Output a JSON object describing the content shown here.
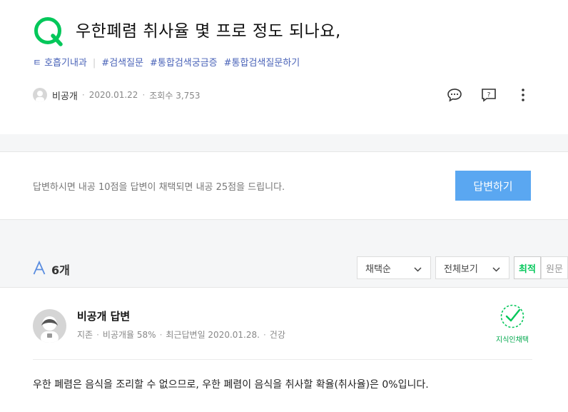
{
  "question": {
    "title": "우한폐렴 취사율 몇 프로 정도 되나요,",
    "tags_prefix": "ㅌ 호흡기내과",
    "tags": [
      "#검색질문",
      "#통합검색궁금증",
      "#통합검색질문하기"
    ],
    "author": "비공개",
    "date": "2020.01.22",
    "views": "조회수 3,753"
  },
  "answer_prompt": {
    "text": "답변하시면 내공 10점을 답변이 채택되면 내공 25점을 드립니다.",
    "button": "답변하기"
  },
  "answers_header": {
    "count": "6개",
    "sort": "채택순",
    "view": "전체보기",
    "tab_latest": "최적",
    "tab_other": "원문"
  },
  "answer": {
    "title": "비공개 답변",
    "grade": "지존",
    "rate": "비공개율 58%",
    "recent": "최근답변일 2020.01.28.",
    "category": "건강",
    "badge": "지식인채택",
    "body": "우한 폐렴은 음식을 조리할 수 없으므로, 우한 폐렴이 음식을 취사할 확율(취사율)은 0%입니다."
  },
  "colors": {
    "brand_green": "#03c75a",
    "button_blue": "#5aa7f1",
    "tag_blue": "#4a63b8"
  }
}
